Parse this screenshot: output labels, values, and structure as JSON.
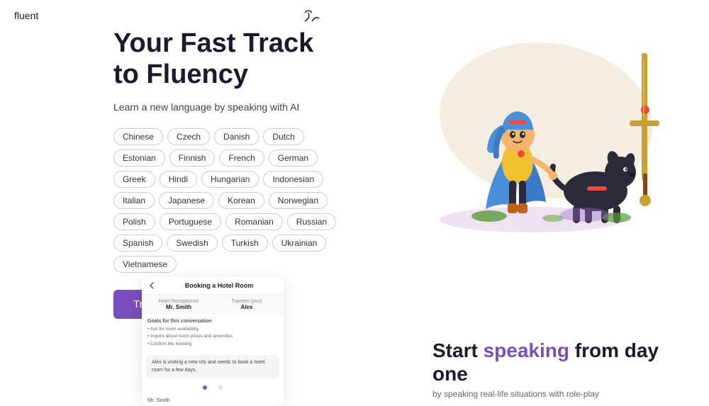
{
  "header": {
    "logo": "fluent"
  },
  "hero": {
    "title_line1": "Your Fast Track",
    "title_line2": "to Fluency",
    "subtitle": "Learn a new language by speaking with AI",
    "cta_label": "Try it out"
  },
  "languages": [
    "Chinese",
    "Czech",
    "Danish",
    "Dutch",
    "Estonian",
    "Finnish",
    "French",
    "German",
    "Greek",
    "Hindi",
    "Hungarian",
    "Indonesian",
    "Italian",
    "Japanese",
    "Korean",
    "Norwegian",
    "Polish",
    "Portuguese",
    "Romanian",
    "Russian",
    "Spanish",
    "Swedish",
    "Turkish",
    "Ukrainian",
    "Vietnamese"
  ],
  "booking_card": {
    "title": "Booking a Hotel Room",
    "role1_label": "Hotel Receptionist",
    "role1_name": "Mr. Smith",
    "role2_label": "Traveler (you)",
    "role2_name": "Alex",
    "goals_title": "Goals for this conversation",
    "goals": [
      "• Ask for room availability",
      "• Inquire about room prices and amenities",
      "• Confirm the booking"
    ],
    "scenario": "Alex is visiting a new city and needs to book a hotel room for a few days.",
    "name_tag": "Mr. Smith"
  },
  "right_bottom": {
    "title_part1": "Start ",
    "title_highlight": "speaking",
    "title_part2": " from day one",
    "subtitle": "by speaking real-life situations with role-play"
  },
  "bird_unicode": "↗",
  "colors": {
    "accent": "#7c4dbd",
    "text_dark": "#1a1a2e",
    "text_light": "#666",
    "tag_border": "#ccc",
    "blob": "#f5ede0"
  }
}
